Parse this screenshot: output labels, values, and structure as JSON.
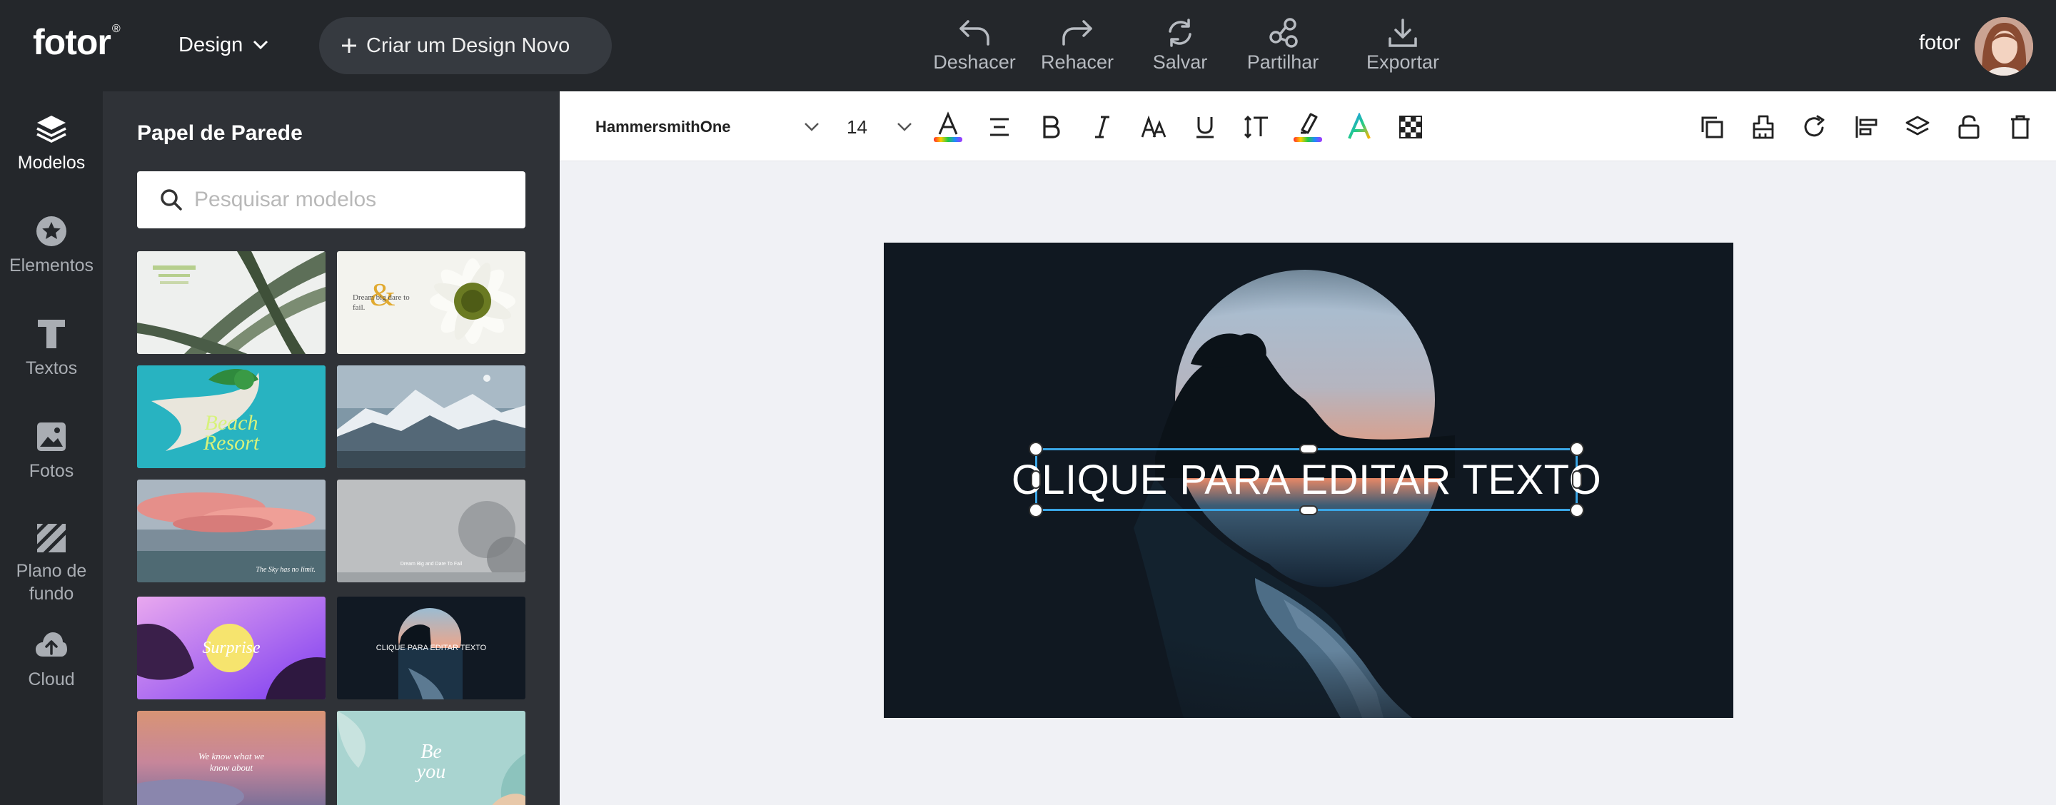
{
  "app": {
    "logo": "fotor",
    "logo_mark": "®",
    "design_menu": "Design",
    "new_design": "Criar um Design Novo",
    "user_name": "fotor"
  },
  "top_actions": [
    {
      "label": "Deshacer",
      "icon": "undo-icon"
    },
    {
      "label": "Rehacer",
      "icon": "redo-icon"
    },
    {
      "label": "Salvar",
      "icon": "sync-save-icon"
    },
    {
      "label": "Partilhar",
      "icon": "share-icon"
    },
    {
      "label": "Exportar",
      "icon": "download-icon"
    }
  ],
  "rail": [
    {
      "label": "Modelos",
      "icon": "layers-icon",
      "active": true
    },
    {
      "label": "Elementos",
      "icon": "star-icon"
    },
    {
      "label": "Textos",
      "icon": "text-t-icon"
    },
    {
      "label": "Fotos",
      "icon": "image-icon"
    },
    {
      "label": "Plano de fundo",
      "icon": "background-icon"
    },
    {
      "label": "Cloud",
      "icon": "cloud-upload-icon"
    }
  ],
  "panel": {
    "title": "Papel de Parede",
    "search_placeholder": "Pesquisar modelos",
    "search_value": "",
    "thumb_texts": {
      "t2": "Dream big dare to fail.",
      "t3": "Beach Resort",
      "t5": "The Sky has no limit.",
      "t6": "Dream Big and Dare To Fail",
      "t7": "Surprise",
      "t8": "CLIQUE PARA EDITAR TEXTO",
      "t9": "We know what we know about",
      "t10": "Be you"
    }
  },
  "format_toolbar": {
    "font": "HammersmithOne",
    "size": "14",
    "tools_left": [
      "text-color-icon",
      "align-icon",
      "bold-icon",
      "italic-icon",
      "letter-case-icon",
      "underline-icon",
      "line-spacing-icon",
      "highlight-icon",
      "gradient-text-icon",
      "transparency-icon"
    ],
    "tools_right": [
      "duplicate-icon",
      "format-painter-icon",
      "rotate-icon",
      "align-left-icon",
      "layers-order-icon",
      "lock-icon",
      "delete-icon"
    ]
  },
  "canvas": {
    "text": "CLIQUE PARA EDITAR TEXTO",
    "selection_color": "#3aa6e6",
    "background": "#101821"
  },
  "colors": {
    "topbar": "#24272b",
    "panel": "#2f3237",
    "workspace": "#f0f1f5"
  }
}
